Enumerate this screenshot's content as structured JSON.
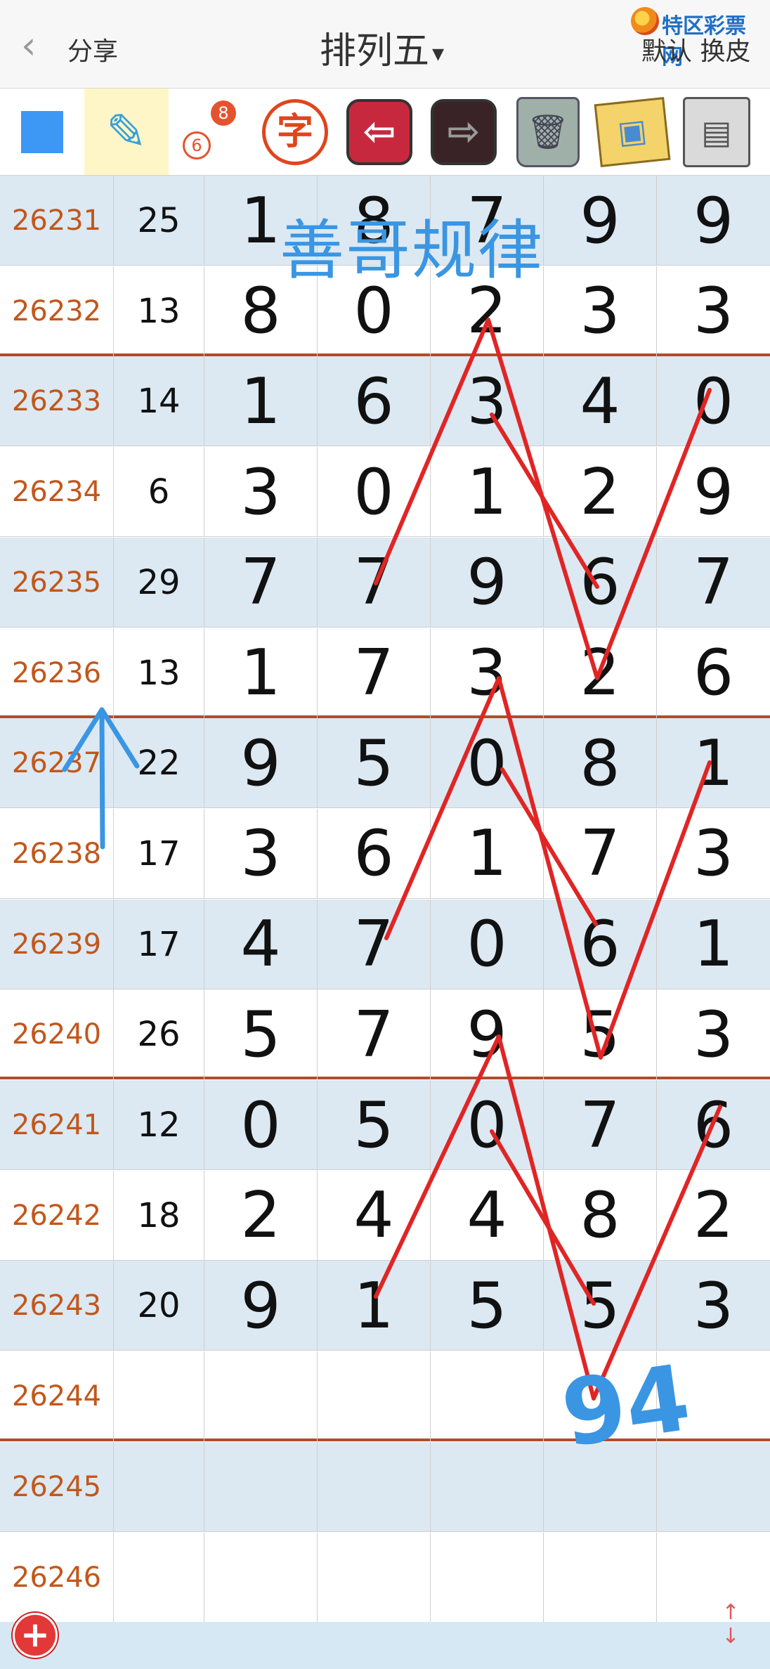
{
  "header": {
    "back_icon": "chevron-left-icon",
    "share_label": "分享",
    "title": "排列五",
    "title_caret": "▾",
    "logo_text": "特区彩票网",
    "skin_label": "默认 换皮"
  },
  "toolbar": {
    "tools": [
      {
        "name": "color-square-icon"
      },
      {
        "name": "pen-tool-icon"
      },
      {
        "name": "number-link-icon",
        "num_top": "8",
        "num_bottom": "6"
      },
      {
        "name": "text-tool-icon",
        "glyph": "字"
      },
      {
        "name": "undo-arrow-icon",
        "glyph": "⇦"
      },
      {
        "name": "redo-arrow-icon",
        "glyph": "⇨"
      },
      {
        "name": "trash-icon",
        "glyph": "🗑"
      },
      {
        "name": "photos-icon",
        "glyph": "▣"
      },
      {
        "name": "save-disk-icon",
        "glyph": "▤"
      }
    ]
  },
  "table": {
    "rows": [
      {
        "issue": "26231",
        "sum": "25",
        "digits": [
          "1",
          "8",
          "7",
          "9",
          "9"
        ]
      },
      {
        "issue": "26232",
        "sum": "13",
        "digits": [
          "8",
          "0",
          "2",
          "3",
          "3"
        ]
      },
      {
        "issue": "26233",
        "sum": "14",
        "digits": [
          "1",
          "6",
          "3",
          "4",
          "0"
        ]
      },
      {
        "issue": "26234",
        "sum": "6",
        "digits": [
          "3",
          "0",
          "1",
          "2",
          "9"
        ]
      },
      {
        "issue": "26235",
        "sum": "29",
        "digits": [
          "7",
          "7",
          "9",
          "6",
          "7"
        ]
      },
      {
        "issue": "26236",
        "sum": "13",
        "digits": [
          "1",
          "7",
          "3",
          "2",
          "6"
        ]
      },
      {
        "issue": "26237",
        "sum": "22",
        "digits": [
          "9",
          "5",
          "0",
          "8",
          "1"
        ]
      },
      {
        "issue": "26238",
        "sum": "17",
        "digits": [
          "3",
          "6",
          "1",
          "7",
          "3"
        ]
      },
      {
        "issue": "26239",
        "sum": "17",
        "digits": [
          "4",
          "7",
          "0",
          "6",
          "1"
        ]
      },
      {
        "issue": "26240",
        "sum": "26",
        "digits": [
          "5",
          "7",
          "9",
          "5",
          "3"
        ]
      },
      {
        "issue": "26241",
        "sum": "12",
        "digits": [
          "0",
          "5",
          "0",
          "7",
          "6"
        ]
      },
      {
        "issue": "26242",
        "sum": "18",
        "digits": [
          "2",
          "4",
          "4",
          "8",
          "2"
        ]
      },
      {
        "issue": "26243",
        "sum": "20",
        "digits": [
          "9",
          "1",
          "5",
          "5",
          "3"
        ]
      },
      {
        "issue": "26244",
        "sum": "",
        "digits": [
          "",
          "",
          "",
          "",
          ""
        ]
      },
      {
        "issue": "26245",
        "sum": "",
        "digits": [
          "",
          "",
          "",
          "",
          ""
        ]
      },
      {
        "issue": "26246",
        "sum": "",
        "digits": [
          "",
          "",
          "",
          "",
          ""
        ]
      }
    ]
  },
  "annotations": {
    "watermark_text": "善哥规律",
    "handwritten_note": "94",
    "stroke_colors": {
      "red": "#e02525",
      "blue": "#3a96e2"
    }
  },
  "footer": {
    "add_icon": "plus-circle-icon",
    "scroll_icon": "scroll-arrows-icon"
  }
}
